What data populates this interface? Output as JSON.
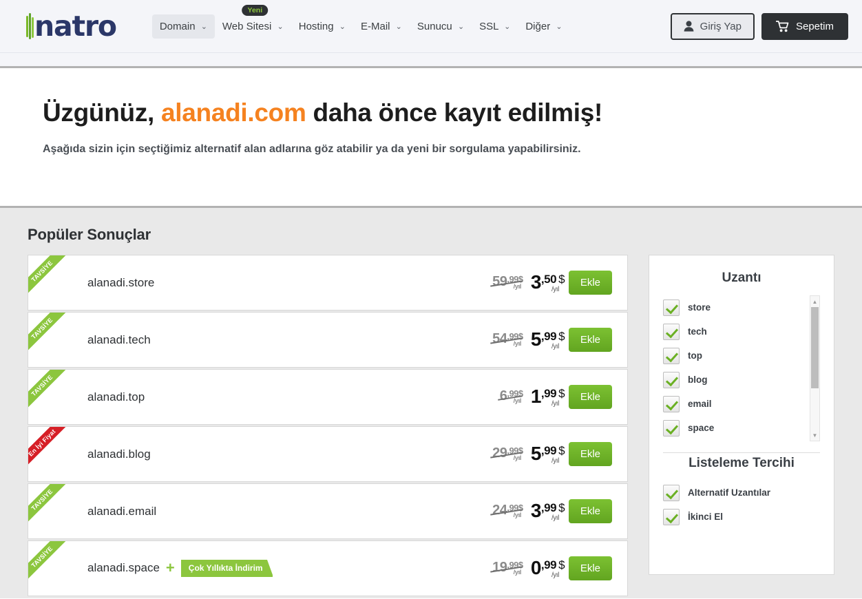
{
  "header": {
    "logo_text": "natro",
    "nav": [
      {
        "label": "Domain",
        "active": true,
        "caret": true,
        "badge": null
      },
      {
        "label": "Web Sitesi",
        "active": false,
        "caret": true,
        "badge": "Yeni"
      },
      {
        "label": "Hosting",
        "active": false,
        "caret": true,
        "badge": null
      },
      {
        "label": "E-Mail",
        "active": false,
        "caret": true,
        "badge": null
      },
      {
        "label": "Sunucu",
        "active": false,
        "caret": true,
        "badge": null
      },
      {
        "label": "SSL",
        "active": false,
        "caret": true,
        "badge": null
      },
      {
        "label": "Diğer",
        "active": false,
        "caret": true,
        "badge": null
      }
    ],
    "login_label": "Giriş Yap",
    "login_icon": "user-icon",
    "cart_label": "Sepetim",
    "cart_icon": "cart-icon"
  },
  "hero": {
    "title_before": "Üzgünüz, ",
    "title_domain": "alanadi.com",
    "title_after": " daha önce kayıt edilmiş!",
    "subtitle": "Aşağıda sizin için seçtiğimiz alternatif alan adlarına göz atabilir ya da yeni bir sorgulama yapabilirsiniz."
  },
  "results": {
    "title": "Popüler Sonuçlar",
    "add_label": "Ekle",
    "currency": "$",
    "period": "/yıl",
    "ribbon_recommended": "TAVSİYE",
    "ribbon_bestprice": "En İyi Fiyat",
    "promo_tag": "Çok Yıllıkta İndirim",
    "rows": [
      {
        "domain": "alanadi.store",
        "ribbon": "TAVSİYE",
        "ribbon_type": "green",
        "old_int": "59",
        "old_frac": ",99",
        "new_int": "3",
        "new_frac": ",50",
        "promo": false
      },
      {
        "domain": "alanadi.tech",
        "ribbon": "TAVSİYE",
        "ribbon_type": "green",
        "old_int": "54",
        "old_frac": ",99",
        "new_int": "5",
        "new_frac": ",99",
        "promo": false
      },
      {
        "domain": "alanadi.top",
        "ribbon": "TAVSİYE",
        "ribbon_type": "green",
        "old_int": "6",
        "old_frac": ",99",
        "new_int": "1",
        "new_frac": ",99",
        "promo": false
      },
      {
        "domain": "alanadi.blog",
        "ribbon": "En İyi Fiyat",
        "ribbon_type": "red",
        "old_int": "29",
        "old_frac": ",99",
        "new_int": "5",
        "new_frac": ",99",
        "promo": false
      },
      {
        "domain": "alanadi.email",
        "ribbon": "TAVSİYE",
        "ribbon_type": "green",
        "old_int": "24",
        "old_frac": ",99",
        "new_int": "3",
        "new_frac": ",99",
        "promo": false
      },
      {
        "domain": "alanadi.space",
        "ribbon": "TAVSİYE",
        "ribbon_type": "green",
        "old_int": "19",
        "old_frac": ",99",
        "new_int": "0",
        "new_frac": ",99",
        "promo": true
      }
    ]
  },
  "sidebar": {
    "extension_title": "Uzantı",
    "extensions": [
      {
        "label": "store",
        "checked": true
      },
      {
        "label": "tech",
        "checked": true
      },
      {
        "label": "top",
        "checked": true
      },
      {
        "label": "blog",
        "checked": true
      },
      {
        "label": "email",
        "checked": true
      },
      {
        "label": "space",
        "checked": true
      }
    ],
    "listing_title": "Listeleme Tercihi",
    "listing": [
      {
        "label": "Alternatif Uzantılar",
        "checked": true
      },
      {
        "label": "İkinci El",
        "checked": true
      }
    ]
  },
  "colors": {
    "accent_orange": "#f58220",
    "accent_green": "#8cc63e",
    "button_green": "#6ab023",
    "dark": "#2e3134",
    "logo_navy": "#2b3768",
    "red": "#d61f26"
  }
}
